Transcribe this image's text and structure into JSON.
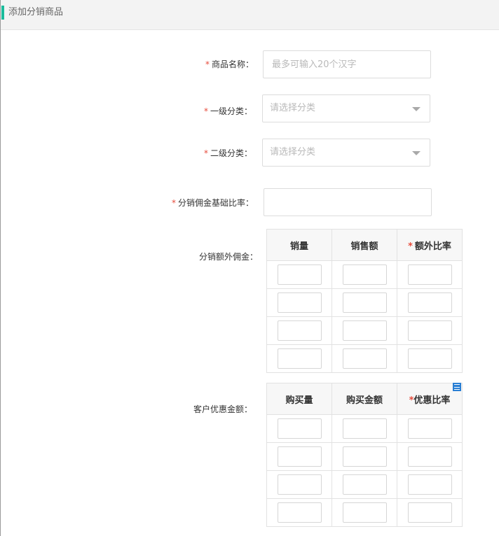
{
  "header": {
    "title": "添加分销商品"
  },
  "form": {
    "product_name": {
      "label": "商品名称：",
      "placeholder": "最多可输入20个汉字",
      "value": ""
    },
    "category_1": {
      "label": "一级分类：",
      "selected": "请选择分类"
    },
    "category_2": {
      "label": "二级分类：",
      "selected": "请选择分类"
    },
    "base_rate": {
      "label": "分销佣金基础比率：",
      "value": ""
    },
    "extra_commission": {
      "label": "分销额外佣金：",
      "columns": [
        "销量",
        "销售额",
        "额外比率"
      ],
      "required_column_index": 2,
      "rows": [
        [
          "",
          "",
          ""
        ],
        [
          "",
          "",
          ""
        ],
        [
          "",
          "",
          ""
        ],
        [
          "",
          "",
          ""
        ]
      ]
    },
    "customer_discount": {
      "label": "客户优惠金额：",
      "columns": [
        "购买量",
        "购买金额",
        "优惠比率"
      ],
      "required_column_index": 2,
      "rows": [
        [
          "",
          "",
          ""
        ],
        [
          "",
          "",
          ""
        ],
        [
          "",
          "",
          ""
        ],
        [
          "",
          "",
          ""
        ]
      ]
    }
  },
  "required_mark": "*",
  "icons": {
    "list": "list-icon",
    "caret": "chevron-down-icon"
  },
  "colors": {
    "accent": "#1abc9c",
    "required": "#e74c3c",
    "list_icon": "#2a7fd4"
  }
}
